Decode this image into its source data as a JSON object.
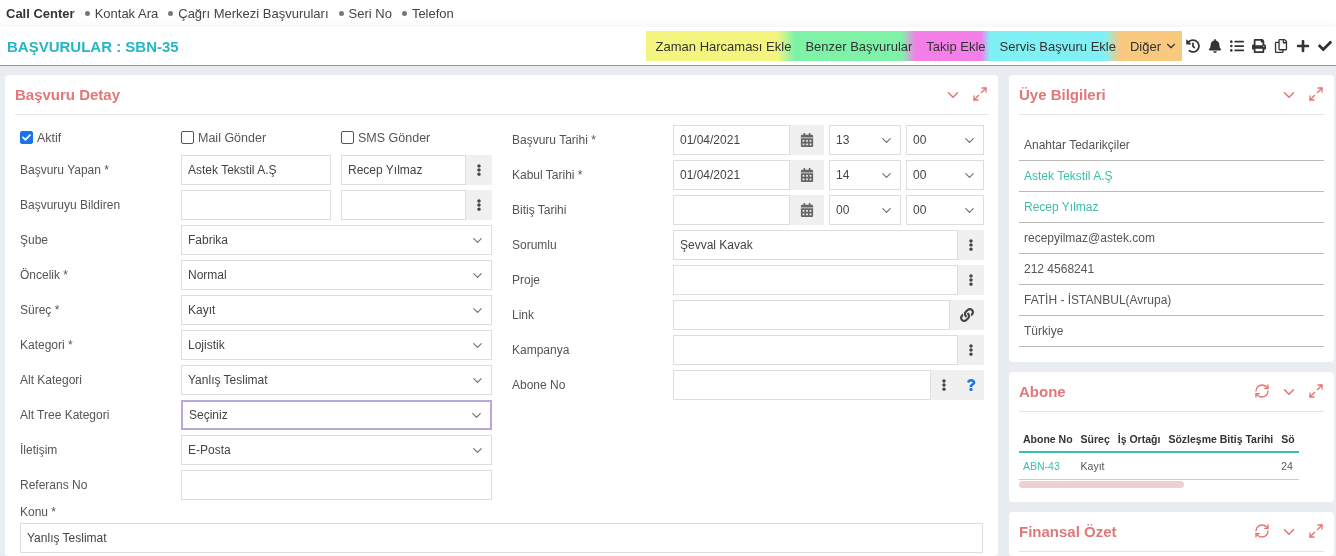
{
  "breadcrumb": {
    "title": "Call Center",
    "items": [
      "Kontak Ara",
      "Çağrı Merkezi Başvuruları",
      "Seri No",
      "Telefon"
    ]
  },
  "header": {
    "title": "BAŞVURULAR : SBN-35",
    "actions": [
      {
        "label": "Zaman Harcaması Ekle",
        "color": "#f4f57f",
        "kind": "button"
      },
      {
        "label": "Benzer Başvurular",
        "color": "#7ef3a8",
        "kind": "button"
      },
      {
        "label": "Takip Ekle",
        "color": "#f47fe8",
        "kind": "button"
      },
      {
        "label": "Servis Başvuru Ekle",
        "color": "#7ff1f5",
        "kind": "button"
      },
      {
        "label": "Diğer",
        "color": "#f8c97f",
        "kind": "dropdown"
      }
    ]
  },
  "detail": {
    "title": "Başvuru Detay",
    "checks": [
      {
        "label": "Aktif",
        "checked": true
      },
      {
        "label": "Mail Gönder",
        "checked": false
      },
      {
        "label": "SMS Gönder",
        "checked": false
      }
    ],
    "left_fields": [
      {
        "label": "Başvuru Yapan *",
        "kind": "double-lookup",
        "values": [
          "Astek Tekstil A.Ş",
          "Recep Yılmaz"
        ]
      },
      {
        "label": "Başvuruyu Bildiren",
        "kind": "double-lookup"
      },
      {
        "label": "Şube",
        "kind": "select",
        "value": "Fabrika",
        "focused": false
      },
      {
        "label": "Öncelik *",
        "kind": "select",
        "value": "Normal",
        "focused": false
      },
      {
        "label": "Süreç *",
        "kind": "select",
        "value": "Kayıt",
        "focused": false
      },
      {
        "label": "Kategori *",
        "kind": "select",
        "value": "Lojistik",
        "focused": false
      },
      {
        "label": "Alt Kategori",
        "kind": "select",
        "value": "Yanlış Teslimat",
        "focused": false
      },
      {
        "label": "Alt Tree Kategori",
        "kind": "select",
        "value": "Seçiniz",
        "focused": true
      },
      {
        "label": "İletişim",
        "kind": "select",
        "value": "E-Posta",
        "focused": false
      },
      {
        "label": "Referans No",
        "kind": "text"
      }
    ],
    "right_fields": [
      {
        "label": "Başvuru Tarihi *",
        "kind": "datetime",
        "date": "01/04/2021",
        "hour": "13",
        "minute": "00"
      },
      {
        "label": "Kabul Tarihi *",
        "kind": "datetime",
        "date": "01/04/2021",
        "hour": "14",
        "minute": "00"
      },
      {
        "label": "Bitiş Tarihi",
        "kind": "datetime",
        "hour": "00",
        "minute": "00"
      },
      {
        "label": "Sorumlu",
        "kind": "lookup",
        "value": "Şevval Kavak"
      },
      {
        "label": "Proje",
        "kind": "lookup"
      },
      {
        "label": "Link",
        "kind": "link"
      },
      {
        "label": "Kampanya",
        "kind": "lookup"
      },
      {
        "label": "Abone No",
        "kind": "lookup-help"
      }
    ],
    "subject": {
      "label": "Konu *",
      "value": "Yanlış Teslimat"
    }
  },
  "member": {
    "title": "Üye Bilgileri",
    "refresh": false,
    "items": [
      {
        "text": "Anahtar Tedarikçiler",
        "kind": "plain"
      },
      {
        "text": "Astek Tekstil A.Ş",
        "kind": "link"
      },
      {
        "text": "Recep Yılmaz",
        "kind": "link"
      },
      {
        "text": "recepyilmaz@astek.com",
        "kind": "plain"
      },
      {
        "text": "212 4568241",
        "kind": "plain"
      },
      {
        "text": "FATİH - İSTANBUL(Avrupa)",
        "kind": "plain"
      },
      {
        "text": "Türkiye",
        "kind": "plain"
      }
    ]
  },
  "subscriber": {
    "title": "Abone",
    "refresh": true,
    "table": {
      "columns": [
        "Abone No",
        "Süreç",
        "İş Ortağı",
        "Sözleşme Bitiş Tarihi",
        "Sö"
      ],
      "rows": [
        {
          "cells": [
            {
              "text": "ABN-43",
              "kind": "link"
            },
            {
              "text": "Kayıt",
              "kind": "plain"
            },
            null,
            null,
            {
              "text": "24",
              "kind": "plain"
            }
          ]
        }
      ]
    }
  },
  "finance": {
    "title": "Finansal Özet",
    "refresh": true
  }
}
